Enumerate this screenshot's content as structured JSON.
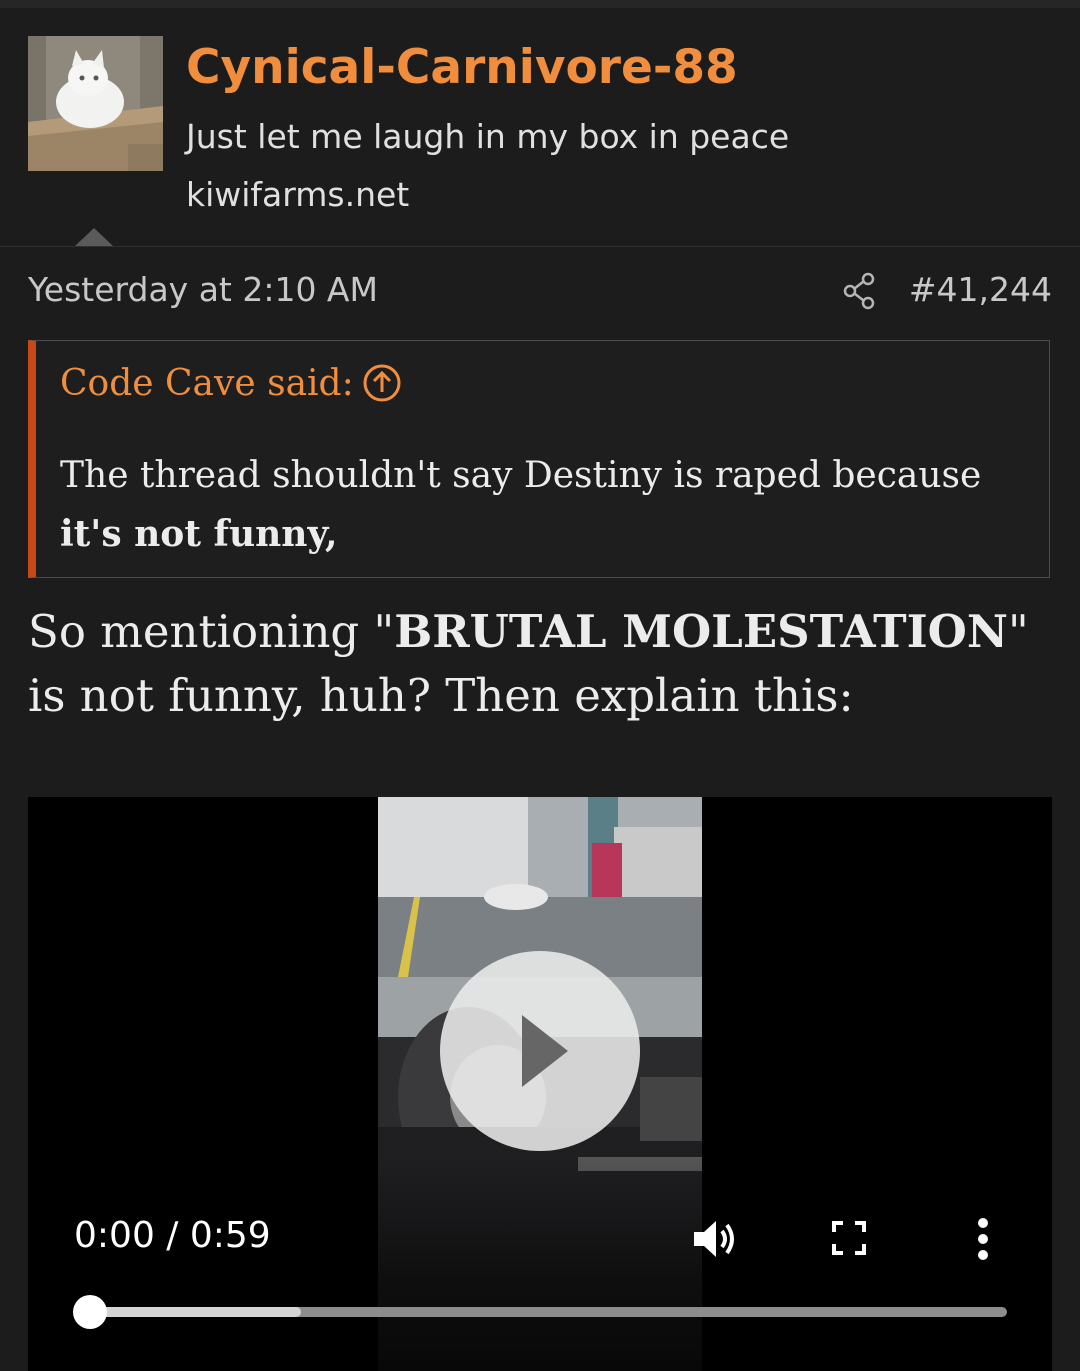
{
  "post": {
    "username": "Cynical-Carnivore-88",
    "user_title": "Just let me laugh in my box in peace",
    "user_site": "kiwifarms.net",
    "timestamp": "Yesterday at 2:10 AM",
    "post_number": "#41,244",
    "icons": {
      "avatar": "white-cat-in-box-avatar",
      "share": "share-icon",
      "quote_jump": "arrow-up-circle-icon"
    },
    "colors": {
      "username": "#f08e3e",
      "quote_bar": "#c8481a",
      "background": "#1c1c1c"
    }
  },
  "quote": {
    "author_label": "Code Cave said:",
    "text_plain": "The thread shouldn't say Destiny is raped because ",
    "text_bold": "it's not funny,"
  },
  "body": {
    "part1": "So mentioning \"",
    "bold": "BRUTAL MOLESTATION",
    "part2": "\" is not funny, huh? Then explain this:"
  },
  "video": {
    "time_display": "0:00 / 0:59",
    "progress_fraction": 0.0,
    "buffered_fraction": 0.23,
    "icons": {
      "play": "play-icon",
      "volume": "volume-icon",
      "fullscreen": "fullscreen-icon",
      "more": "more-vert-icon"
    }
  }
}
